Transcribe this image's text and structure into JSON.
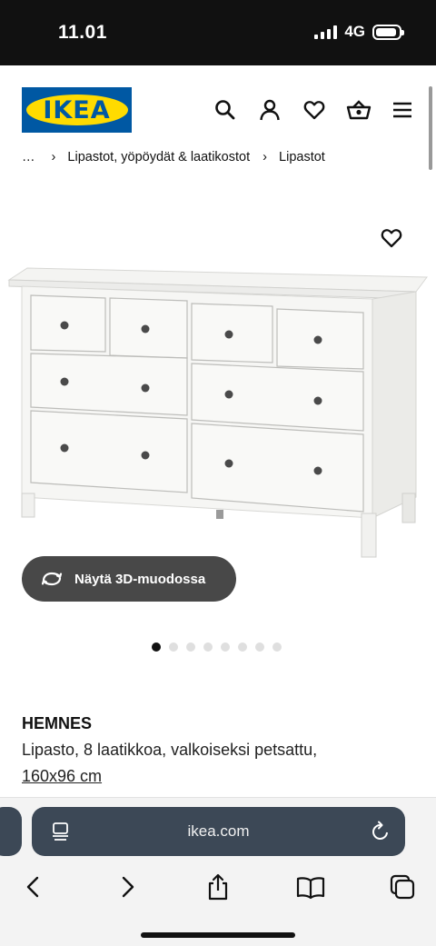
{
  "status": {
    "time": "11.01",
    "network": "4G",
    "battery_level": 0.9
  },
  "header": {
    "logo_text": "IKEA",
    "icons": [
      "search-icon",
      "user-icon",
      "heart-icon",
      "basket-icon",
      "menu-icon"
    ]
  },
  "breadcrumb": {
    "items": [
      "…",
      "Lipastot, yöpöydät & laatikostot",
      "Lipastot"
    ]
  },
  "gallery": {
    "view_3d_label": "Näytä 3D-muodossa",
    "image_count": 8,
    "active_index": 0
  },
  "product": {
    "name": "HEMNES",
    "description": "Lipasto, 8 laatikkoa, valkoiseksi petsattu,",
    "size": "160x96 cm"
  },
  "browser": {
    "url": "ikea.com"
  },
  "colors": {
    "ikea_blue": "#0058a3",
    "ikea_yellow": "#ffdb00",
    "button_dark": "#484848",
    "url_bar": "#3c4856"
  }
}
